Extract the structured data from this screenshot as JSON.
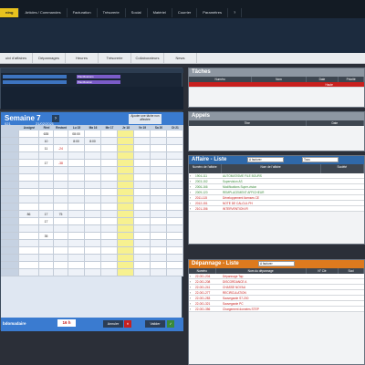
{
  "menu": [
    "ning",
    "Articles / Commandes",
    "Facturation",
    "Trésorerie",
    "Social",
    "Matériel",
    "Courrier",
    "Paramètres",
    "?"
  ],
  "tabs": [
    "uivi d'affaires",
    "Dépannages",
    "Heures",
    "Trésorerie",
    "Collaborateurs",
    "News"
  ],
  "gantt": {
    "labels": [
      "Planifications",
      "Intervention Travaux CE",
      "Planification",
      "Intervention"
    ]
  },
  "week": {
    "title": "Semaine 7",
    "date_start": "021",
    "date_end": "21/02/2021",
    "add_btn": "Ajouter une tâche non affectée",
    "cols": [
      "Assigné",
      "Réel",
      "Restant",
      "Lu 15",
      "Ma 16",
      "Me 17",
      "Je 18",
      "Ve 19",
      "Sa 20",
      "Di 21"
    ],
    "rows": [
      [
        "",
        "635",
        "",
        "08:00",
        "",
        "",
        "",
        "",
        "",
        ""
      ],
      [
        "",
        "10",
        "",
        "8:00",
        "8:00",
        "",
        "",
        "",
        "",
        ""
      ],
      [
        "",
        "11",
        "-24",
        "",
        "",
        "",
        "",
        "",
        "",
        ""
      ],
      [
        "",
        "",
        "",
        "",
        "",
        "",
        "",
        "",
        "",
        ""
      ],
      [
        "",
        "17",
        "-38",
        "",
        "",
        "",
        "",
        "",
        "",
        ""
      ],
      [
        "",
        "",
        "",
        "",
        "",
        "",
        "",
        "",
        "",
        ""
      ],
      [
        "",
        "",
        "",
        "",
        "",
        "",
        "",
        "",
        "",
        ""
      ],
      [
        "",
        "",
        "",
        "",
        "",
        "",
        "",
        "",
        "",
        ""
      ],
      [
        "",
        "",
        "",
        "",
        "",
        "",
        "",
        "",
        "",
        ""
      ],
      [
        "",
        "",
        "",
        "",
        "",
        "",
        "",
        "",
        "",
        ""
      ],
      [
        "",
        "",
        "",
        "",
        "",
        "",
        "",
        "",
        "",
        ""
      ],
      [
        "86",
        "17",
        "75",
        "",
        "",
        "",
        "",
        "",
        "",
        ""
      ],
      [
        "",
        "17",
        "",
        "",
        "",
        "",
        "",
        "",
        "",
        ""
      ],
      [
        "",
        "",
        "",
        "",
        "",
        "",
        "",
        "",
        "",
        ""
      ],
      [
        "",
        "35",
        "",
        "",
        "",
        "",
        "",
        "",
        "",
        ""
      ],
      [
        "",
        "",
        "",
        "",
        "",
        "",
        "",
        "",
        "",
        ""
      ],
      [
        "",
        "",
        "",
        "",
        "",
        "",
        "",
        "",
        "",
        ""
      ],
      [
        "",
        "",
        "",
        "",
        "",
        "",
        "",
        "",
        "",
        ""
      ],
      [
        "",
        "",
        "",
        "",
        "",
        "",
        "",
        "",
        "",
        ""
      ],
      [
        "",
        "",
        "",
        "",
        "",
        "",
        "",
        "",
        "",
        ""
      ]
    ],
    "footer_label": "bdomadaire",
    "footer_value": "16 h",
    "annuler": "Annuler",
    "valider": "Valider"
  },
  "taches": {
    "title": "Tâches",
    "cols": [
      "Numéro",
      "Nom",
      "Date",
      "Priorité"
    ],
    "row_priority": "Haute"
  },
  "appels": {
    "title": "Appels",
    "cols": [
      "Titre",
      "Date"
    ]
  },
  "affaires": {
    "title": "Affaire - Liste",
    "filter1": "A facturer",
    "filter2": "Tous",
    "cols": [
      "Numéro de l'affaire",
      "Nom de l'affaire",
      "Société"
    ],
    "rows": [
      [
        "1904-111",
        "AUTOMATISME FILE BOURS"
      ],
      [
        "2003-152",
        "Supervision AS"
      ],
      [
        "2006-166",
        "Modifications Super-vision"
      ],
      [
        "2009-120",
        "REMPLACEMENT AFFICHEUR"
      ],
      [
        "2011-115",
        "Développement licenses CE"
      ],
      [
        "2012-151",
        "NOTE DE CALCUL PH"
      ],
      [
        "2101-156",
        "INTERVENTION IR"
      ]
    ]
  },
  "depannage": {
    "title": "Dépannage - Liste",
    "filter1": "A facturer",
    "cols": [
      "Numéro",
      "Nom du dépannage",
      "N° Clé",
      "Soci"
    ],
    "rows": [
      [
        "22-001-204",
        "Dépannage Tap"
      ],
      [
        "22-001-208",
        "DISCORDANCE A"
      ],
      [
        "22-001-241",
        "CHASSE NOYAU"
      ],
      [
        "22-001-277",
        "RECIRCULATION"
      ],
      [
        "22-001-283",
        "Sauvegarde S7-200"
      ],
      [
        "22-001-321",
        "Sauvegarde PC"
      ],
      [
        "22-001-356",
        "Chargement données STEP"
      ]
    ]
  },
  "colors": {
    "accent": "#e8c21e",
    "blue": "#2f68a8",
    "orange": "#dd7a1e",
    "red": "#c8201e",
    "green": "#3a8a3a"
  }
}
